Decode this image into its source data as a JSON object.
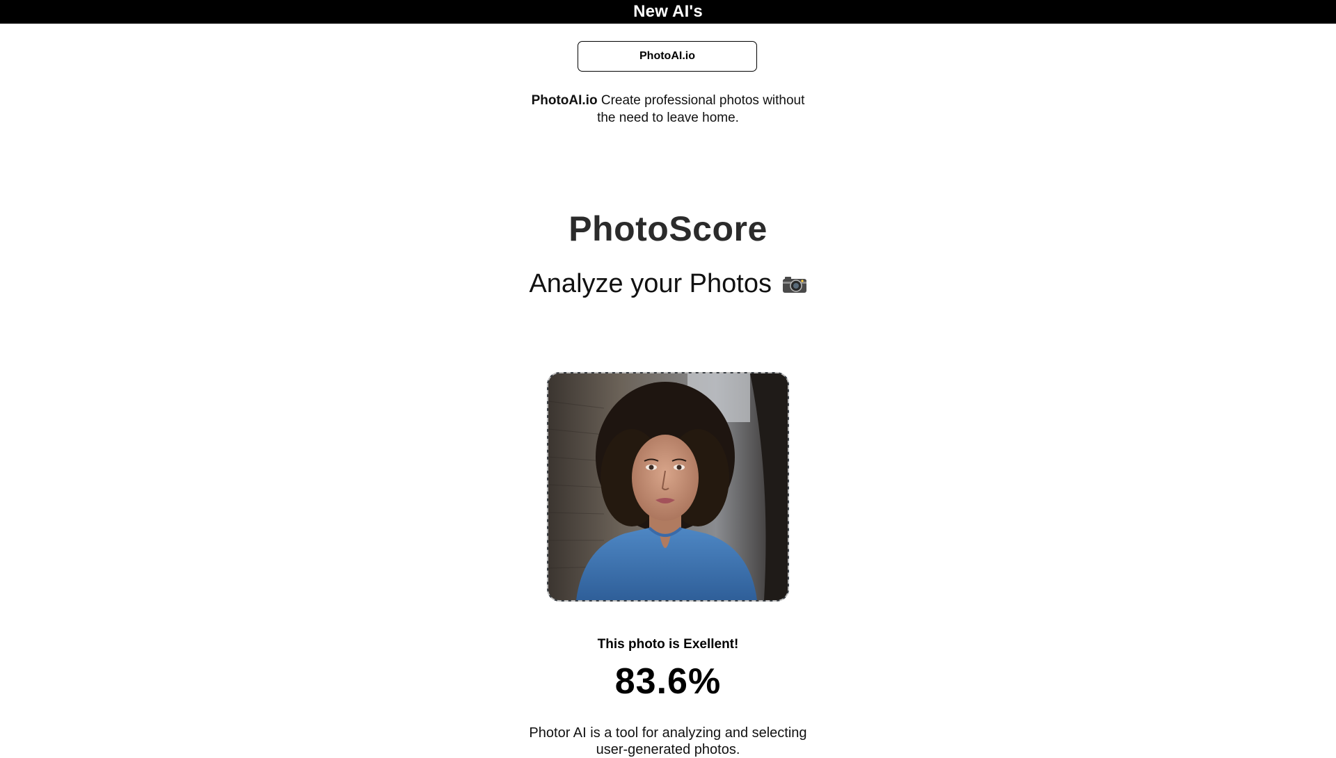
{
  "header": {
    "title": "New AI's"
  },
  "promo": {
    "button_label": "PhotoAI.io",
    "brand": "PhotoAI.io",
    "tagline": " Create professional photos without the need to leave home."
  },
  "main": {
    "title": "PhotoScore",
    "subtitle": "Analyze your Photos",
    "subtitle_icon": "camera-icon",
    "photo_alt": "portrait of a woman with curly hair in a blue blouse",
    "result_label": "This photo is Exellent!",
    "score": "83.6%",
    "description": "Photor AI is a tool for analyzing and selecting user-generated photos."
  },
  "colors": {
    "topbar_bg": "#000000",
    "title": "#2b2b2b",
    "photo_border": "#bdbdbd"
  }
}
